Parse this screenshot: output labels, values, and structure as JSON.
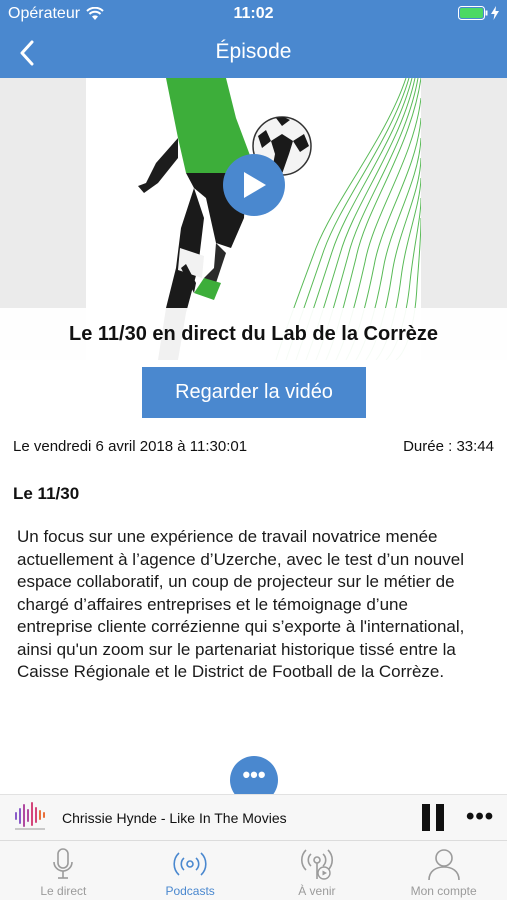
{
  "status_bar": {
    "carrier": "Opérateur",
    "time": "11:02"
  },
  "nav": {
    "title": "Épisode",
    "back_icon": "chevron-left-icon"
  },
  "episode": {
    "caption": "Le 11/30 en direct du Lab de la Corrèze",
    "watch_video_label": "Regarder la vidéo",
    "date": "Le vendredi 6 avril 2018 à 11:30:01",
    "duration": "Durée : 33:44",
    "show_name": "Le 11/30",
    "description": "Un focus sur une expérience de travail novatrice menée actuellement à l’agence d’Uzerche, avec le test d’un nouvel espace collaboratif, un coup de projecteur sur le métier de chargé d’affaires entreprises et le témoignage d’une entreprise cliente corrézienne qui s’exporte à l'international, ainsi qu'un zoom sur le partenariat historique tissé entre la Caisse Régionale et le District de Football de la Corrèze.",
    "more_label": "•••"
  },
  "player": {
    "track": "Chrissie Hynde - Like In The Movies",
    "menu_label": "•••"
  },
  "tabs": [
    {
      "label": "Le direct",
      "icon": "microphone-icon",
      "active": false
    },
    {
      "label": "Podcasts",
      "icon": "broadcast-icon",
      "active": true
    },
    {
      "label": "À venir",
      "icon": "podcast-play-icon",
      "active": false
    },
    {
      "label": "Mon compte",
      "icon": "user-icon",
      "active": false
    }
  ],
  "colors": {
    "accent": "#4a88cf",
    "tab_inactive": "#9b9b9b",
    "hero_green": "#3dae3a"
  }
}
